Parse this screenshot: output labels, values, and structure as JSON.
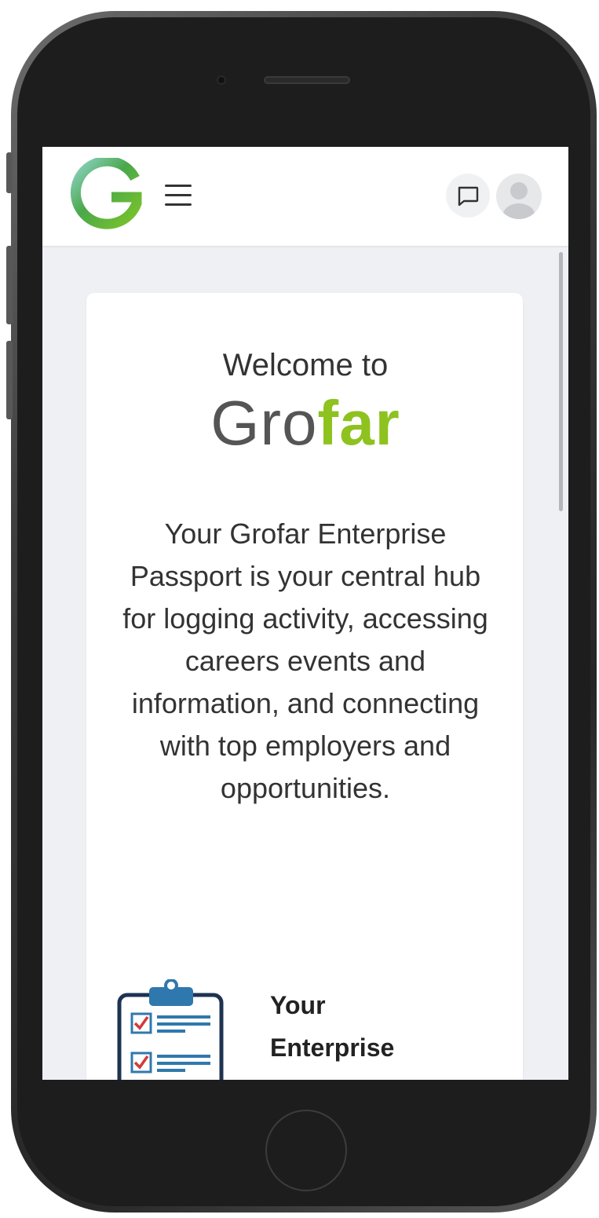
{
  "header": {
    "logo_letter": "G",
    "menu_icon": "hamburger-menu-icon",
    "chat_icon": "chat-bubble-icon",
    "avatar_icon": "user-avatar-icon"
  },
  "welcome": {
    "heading": "Welcome to",
    "brand_part1": "Gro",
    "brand_part2": "far",
    "brand_colors": {
      "gro": "#555555",
      "far": "#8ec21f"
    },
    "intro": "Your Grofar Enterprise Passport is your central hub for logging activity, accessing careers events and information, and connecting with top employers and opportunities."
  },
  "feature": {
    "icon": "clipboard-checklist-icon",
    "title": "Your Enterprise Passport"
  }
}
